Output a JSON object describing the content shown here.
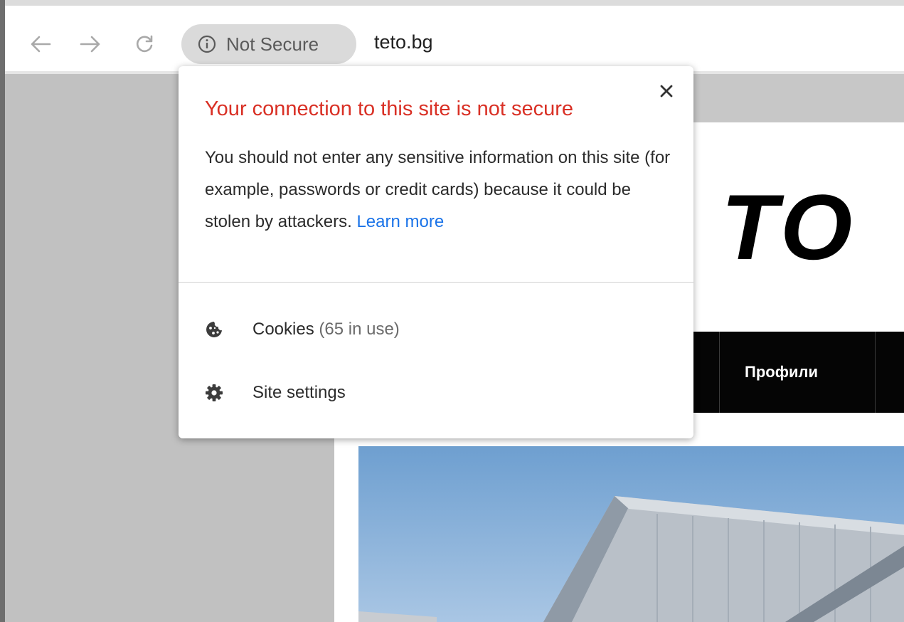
{
  "browser": {
    "security_chip": {
      "label": "Not Secure",
      "icon": "info-icon"
    },
    "url": "teto.bg",
    "nav": {
      "back_icon": "arrow-left-icon",
      "forward_icon": "arrow-right-icon",
      "reload_icon": "reload-icon"
    }
  },
  "page": {
    "logo_partial": "TO",
    "nav_item": "Профили"
  },
  "popup": {
    "title": "Your connection to this site is not secure",
    "body": "You should not enter any sensitive information on this site (for example, passwords or credit cards) because it could be stolen by attackers.",
    "learn_more": "Learn more",
    "close_icon": "close-icon",
    "cookies": {
      "label": "Cookies",
      "count": "(65 in use)",
      "icon": "cookie-icon"
    },
    "site_settings": {
      "label": "Site settings",
      "icon": "gear-icon"
    },
    "title_color": "#d93025",
    "link_color": "#1a73e8"
  }
}
